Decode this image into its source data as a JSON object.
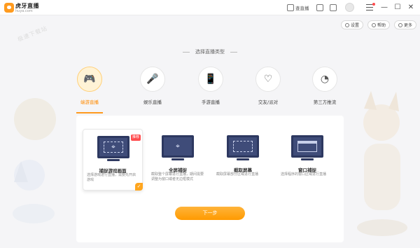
{
  "app": {
    "brand": "虎牙直播",
    "brand_sub": "huya.com"
  },
  "titlebar": {
    "my_live": "查直播",
    "icons": [
      "play-icon",
      "download-icon",
      "gamepad-icon",
      "avatar",
      "menu-icon"
    ],
    "window_controls": {
      "minimize": "—",
      "maximize": "☐",
      "close": "✕"
    }
  },
  "watermark": "极速下载站",
  "toolbar2": {
    "settings": "设置",
    "help": "帮助",
    "more": "更多"
  },
  "section_title": "选择直播类型",
  "live_types": [
    {
      "label": "端游直播",
      "icon": "gamepad-icon",
      "active": true
    },
    {
      "label": "娱乐直播",
      "icon": "microphone-icon",
      "active": false
    },
    {
      "label": "手游直播",
      "icon": "phone-icon",
      "active": false
    },
    {
      "label": "交友/派对",
      "icon": "heart-icon",
      "active": false
    },
    {
      "label": "第三方推流",
      "icon": "stream-icon",
      "active": false
    }
  ],
  "capture_modes": [
    {
      "title": "捕捉游戏画面",
      "desc": "选择游戏进行直播，需要先开启游戏",
      "badge": "推荐",
      "selected": true
    },
    {
      "title": "全屏捕捉",
      "desc": "截取整个屏幕进行直播，期间需要调整为窗口或者无边框模式",
      "badge": "",
      "selected": false
    },
    {
      "title": "截取屏幕",
      "desc": "截取屏幕部分区域进行直播",
      "badge": "",
      "selected": false
    },
    {
      "title": "窗口捕捉",
      "desc": "选择程序的窗口区域进行直播",
      "badge": "",
      "selected": false
    }
  ],
  "next_button": "下一步",
  "colors": {
    "accent": "#ff9a1f",
    "monitor": "#3f4c79",
    "badge": "#ff4d4f"
  }
}
